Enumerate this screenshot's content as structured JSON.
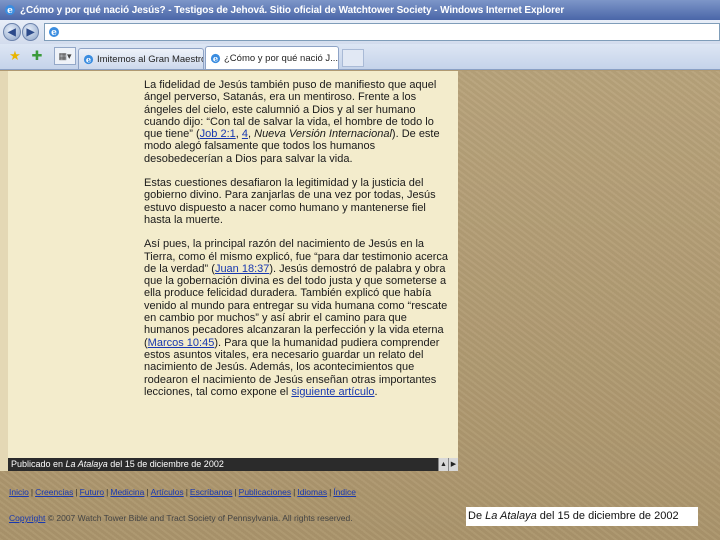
{
  "window": {
    "title": "¿Cómo y por qué nació Jesús? - Testigos de Jehová. Sitio oficial de Watchtower Society - Windows Internet Explorer"
  },
  "address_bar": {
    "url": ""
  },
  "tabs": [
    {
      "label": "Imitemos al Gran Maestro - T..."
    },
    {
      "label": "¿Cómo y por qué nació J..."
    }
  ],
  "article": {
    "p1": {
      "t1": "La fidelidad de Jesús también puso de manifiesto que aquel ángel perverso, Satanás, era un mentiroso. Frente a los ángeles del cielo, este calumnió a Dios y al ser humano cuando dijo: “Con tal de salvar la vida, el hombre de todo lo que tiene” (",
      "link1": "Job 2:1",
      "t2": ", ",
      "link2": "4",
      "t3": ", ",
      "italic": "Nueva Versión Internacional",
      "t4": "). De este modo alegó falsamente que todos los humanos desobedecerían a Dios para salvar la vida."
    },
    "p2": "Estas cuestiones desafiaron la legitimidad y la justicia del gobierno divino. Para zanjarlas de una vez por todas, Jesús estuvo dispuesto a nacer como humano y mantenerse fiel hasta la muerte.",
    "p3": {
      "t1": "Así pues, la principal razón del nacimiento de Jesús en la Tierra, como él mismo explicó, fue “para dar testimonio acerca de la verdad” (",
      "link1": "Juan 18:37",
      "t2": "). Jesús demostró de palabra y obra que la gobernación divina es del todo justa y que someterse a ella produce felicidad duradera. También explicó que había venido al mundo para entregar su vida humana como “rescate en cambio por muchos” y así abrir el camino para que humanos pecadores alcanzaran la perfección y la vida eterna (",
      "link2": "Marcos 10:45",
      "t3": "). Para que la humanidad pudiera comprender estos asuntos vitales, era necesario guardar un relato del nacimiento de Jesús. Además, los acontecimientos que rodearon el nacimiento de Jesús enseñan otras importantes lecciones, tal como expone el ",
      "link3": "siguiente artículo",
      "t4": "."
    }
  },
  "pub_bar": {
    "prefix": "Publicado en ",
    "magazine": "La Atalaya",
    "suffix": " del 15 de diciembre de 2002"
  },
  "footer": {
    "links": [
      "Inicio",
      "Creencias",
      "Futuro",
      "Medicina",
      "Artículos",
      "Escríbanos",
      "Publicaciones",
      "Idiomas",
      "Índice"
    ],
    "separator": "|",
    "copyright_link": "Copyright",
    "copyright_text": " © 2007 Watch Tower Bible and Tract Society of Pennsylvania. All rights reserved."
  },
  "caption": {
    "prefix": "De ",
    "magazine": "La Atalaya",
    "suffix": " del 15 de diciembre de 2002"
  },
  "colors": {
    "title_bar": "#4a66a8",
    "article_bg": "#f3eccc",
    "page_bg": "#b09a72",
    "link": "#1838b0"
  }
}
